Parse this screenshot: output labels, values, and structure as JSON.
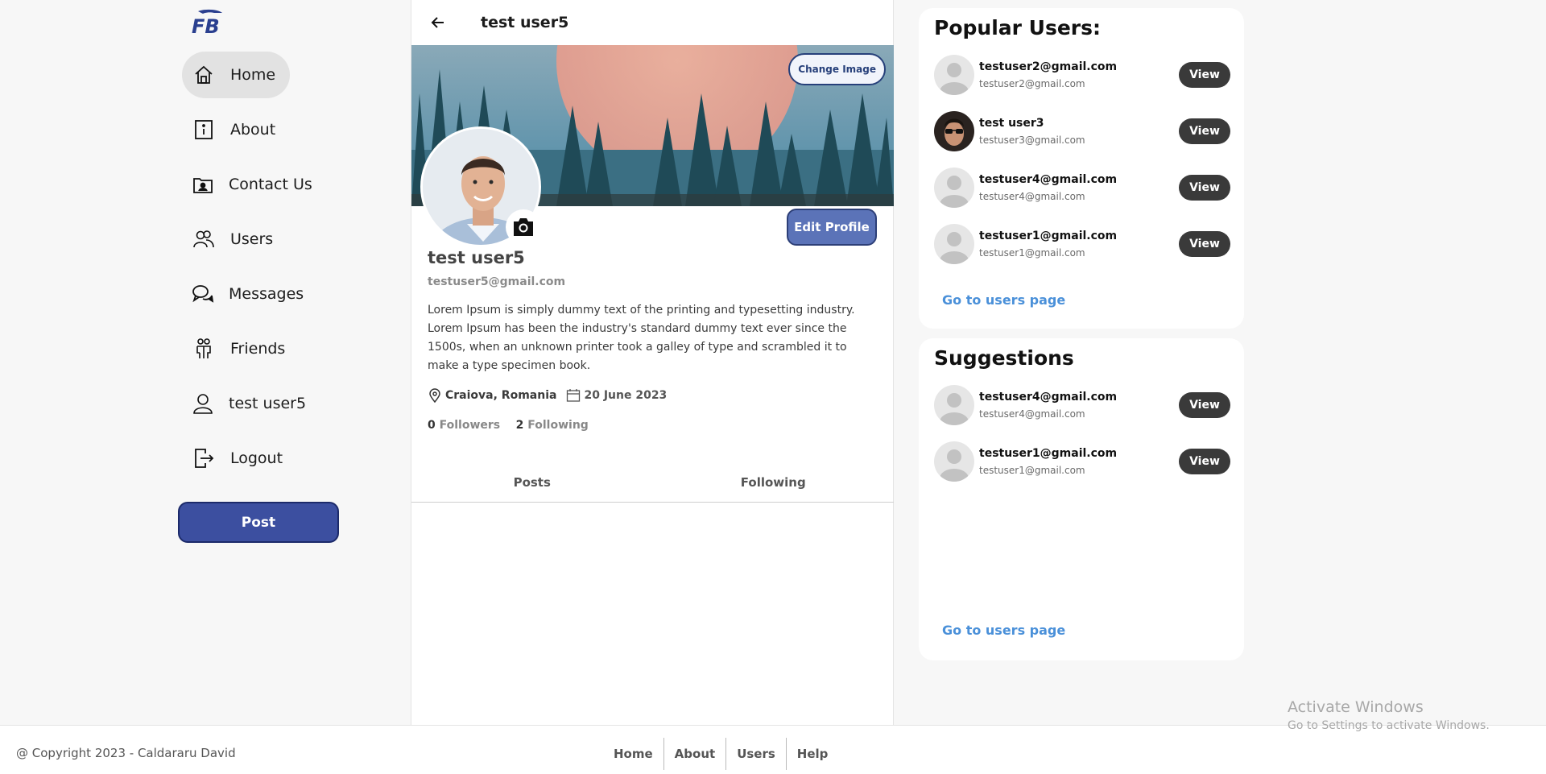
{
  "brand": {
    "logo_text": "FB"
  },
  "sidebar": {
    "items": [
      {
        "label": "Home",
        "icon": "home-icon",
        "active": true
      },
      {
        "label": "About",
        "icon": "info-icon",
        "active": false
      },
      {
        "label": "Contact Us",
        "icon": "contact-card-icon",
        "active": false
      },
      {
        "label": "Users",
        "icon": "users-icon",
        "active": false
      },
      {
        "label": "Messages",
        "icon": "chat-bubbles-icon",
        "active": false
      },
      {
        "label": "Friends",
        "icon": "friends-icon",
        "active": false
      },
      {
        "label": "test user5",
        "icon": "user-icon",
        "active": false
      },
      {
        "label": "Logout",
        "icon": "logout-icon",
        "active": false
      }
    ],
    "post_label": "Post"
  },
  "profile": {
    "header_title": "test user5",
    "change_image_label": "Change Image",
    "edit_profile_label": "Edit Profile",
    "name": "test user5",
    "email": "testuser5@gmail.com",
    "bio": "Lorem Ipsum is simply dummy text of the printing and typesetting industry. Lorem Ipsum has been the industry's standard dummy text ever since the 1500s, when an unknown printer took a galley of type and scrambled it to make a type specimen book.",
    "location": "Craiova, Romania",
    "joined": "20 June 2023",
    "followers_count": "0",
    "followers_label": "Followers",
    "following_count": "2",
    "following_label": "Following",
    "tabs": [
      "Posts",
      "Following"
    ]
  },
  "popular": {
    "title": "Popular Users:",
    "users": [
      {
        "name": "testuser2@gmail.com",
        "email": "testuser2@gmail.com",
        "avatar": "default"
      },
      {
        "name": "test user3",
        "email": "testuser3@gmail.com",
        "avatar": "photo"
      },
      {
        "name": "testuser4@gmail.com",
        "email": "testuser4@gmail.com",
        "avatar": "default"
      },
      {
        "name": "testuser1@gmail.com",
        "email": "testuser1@gmail.com",
        "avatar": "default"
      }
    ],
    "view_label": "View",
    "link_label": "Go to users page"
  },
  "suggestions": {
    "title": "Suggestions",
    "users": [
      {
        "name": "testuser4@gmail.com",
        "email": "testuser4@gmail.com",
        "avatar": "default"
      },
      {
        "name": "testuser1@gmail.com",
        "email": "testuser1@gmail.com",
        "avatar": "default"
      }
    ],
    "view_label": "View",
    "link_label": "Go to users page"
  },
  "footer": {
    "copyright": "@ Copyright 2023 - Caldararu David",
    "links": [
      "Home",
      "About",
      "Users",
      "Help"
    ]
  },
  "watermark": {
    "line1": "Activate Windows",
    "line2": "Go to Settings to activate Windows."
  },
  "colors": {
    "accent": "#3c4fa0",
    "edit_button": "#5b73b8",
    "view_button": "#3a3a3a",
    "link": "#4a90d9",
    "page_bg": "#f7f7f7"
  }
}
